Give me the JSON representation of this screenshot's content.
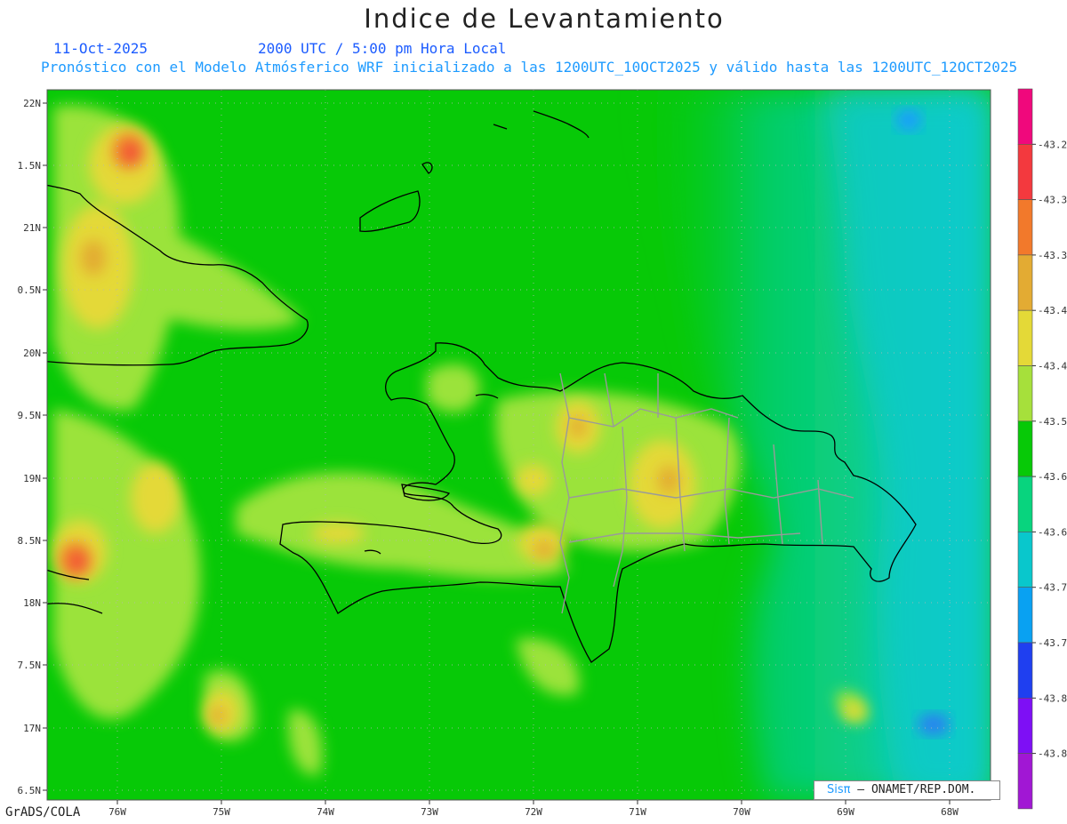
{
  "title": "Indice de Levantamiento",
  "date": "11-Oct-2025",
  "time": "2000 UTC / 5:00 pm Hora Local",
  "forecast": "Pronóstico con el Modelo Atmósferico WRF inicializado a las 1200UTC_10OCT2025 y válido hasta las  1200UTC_12OCT2025",
  "footer": "GrADS/COLA",
  "credit": {
    "logo": "Sisπ",
    "text": " – ONAMET/REP.DOM."
  },
  "lat_labels": [
    "22N",
    "1.5N",
    "21N",
    "0.5N",
    "20N",
    "9.5N",
    "19N",
    "8.5N",
    "18N",
    "7.5N",
    "17N",
    "6.5N"
  ],
  "lon_labels": [
    "76W",
    "75W",
    "74W",
    "73W",
    "72W",
    "71W",
    "70W",
    "69W",
    "68W"
  ],
  "colorbar": {
    "colors": [
      "#f0087c",
      "#f3393e",
      "#f2792b",
      "#e3ab33",
      "#e4d937",
      "#a6e03b",
      "#07c907",
      "#08d47e",
      "#09c7cc",
      "#09a1f2",
      "#1f3ff0",
      "#7e0ff5",
      "#a117d4"
    ],
    "labels": [
      "-43.2",
      "-43.3",
      "-43.3",
      "-43.4",
      "-43.4",
      "-43.5",
      "-43.6",
      "-43.6",
      "-43.7",
      "-43.7",
      "-43.8",
      "-43.8"
    ]
  },
  "colors": {
    "background": "#07c907",
    "land": "#9be33a",
    "ocean_east": "#0dd1c1"
  }
}
